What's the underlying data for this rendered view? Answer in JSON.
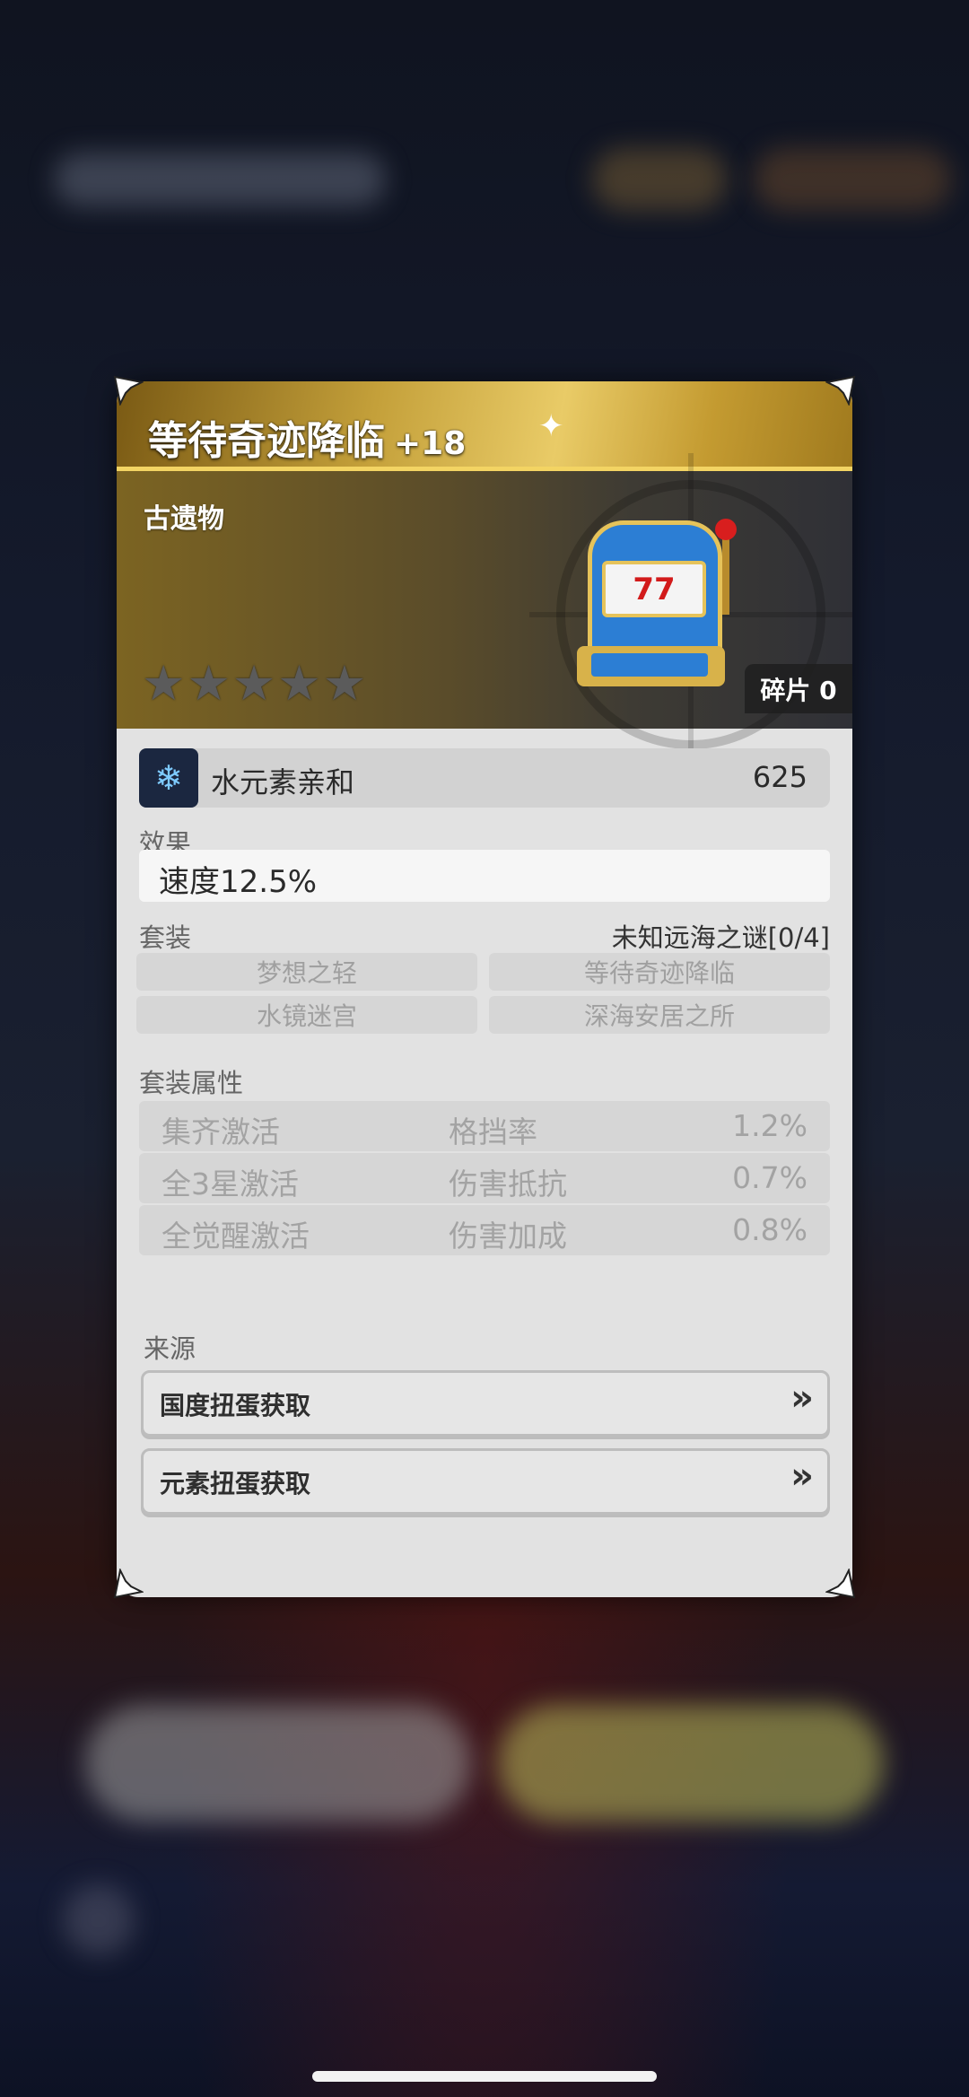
{
  "item": {
    "name": "等待奇迹降临",
    "level": "+18",
    "category": "古遗物",
    "stars_filled": 0,
    "stars_total": 5,
    "shards": "碎片 0",
    "icon": "slot-machine-icon",
    "slot_digits": "77"
  },
  "affinity": {
    "icon": "water-element-icon",
    "label": "水元素亲和",
    "value": "625"
  },
  "effect": {
    "heading": "效果",
    "text": "速度12.5%"
  },
  "set": {
    "heading": "套装",
    "name": "未知远海之谜[0/4]",
    "pieces": [
      "梦想之轻",
      "等待奇迹降临",
      "水镜迷宫",
      "深海安居之所"
    ]
  },
  "set_bonus": {
    "heading": "套装属性",
    "rows": [
      {
        "condition": "集齐激活",
        "stat": "格挡率",
        "value": "1.2%"
      },
      {
        "condition": "全3星激活",
        "stat": "伤害抵抗",
        "value": "0.7%"
      },
      {
        "condition": "全觉醒激活",
        "stat": "伤害加成",
        "value": "0.8%"
      }
    ]
  },
  "source": {
    "heading": "来源",
    "items": [
      {
        "label": "国度扭蛋获取",
        "icon": "double-chevron-right-icon"
      },
      {
        "label": "元素扭蛋获取",
        "icon": "double-chevron-right-icon"
      }
    ]
  },
  "colors": {
    "header_gold": "#e9cb67",
    "card_bg": "#e2e2e2",
    "accent_blue": "#2c7ed4"
  }
}
